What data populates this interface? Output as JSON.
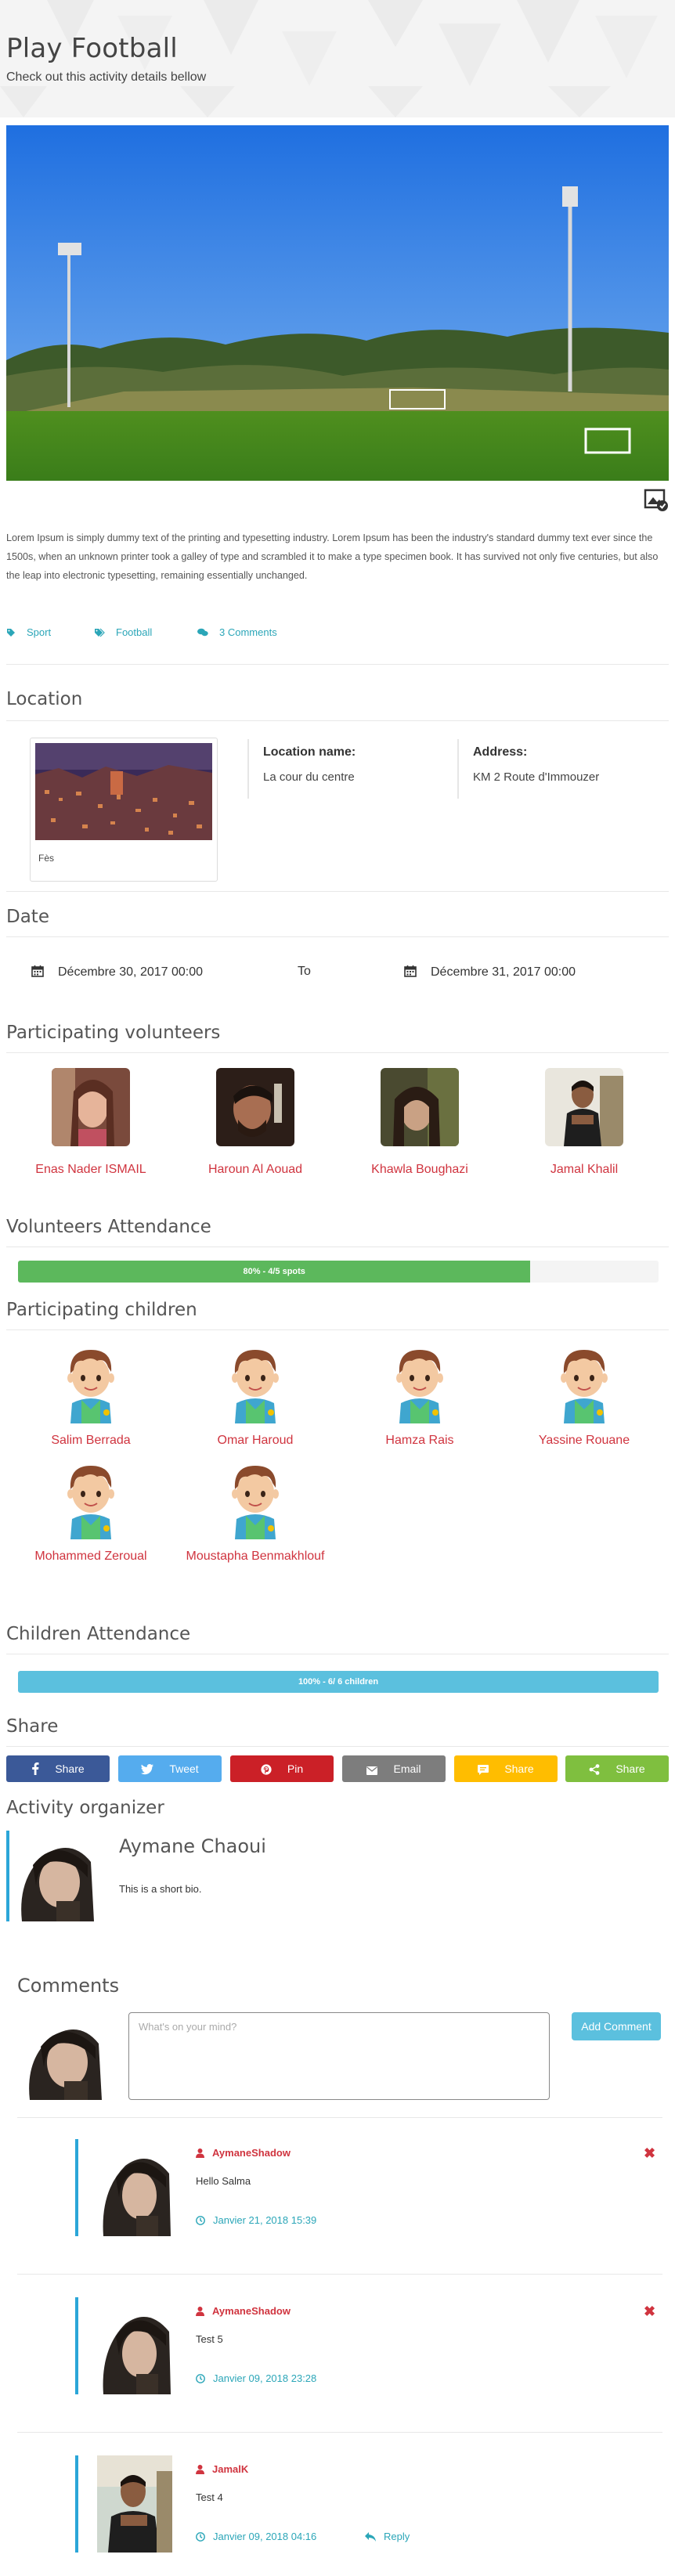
{
  "header": {
    "title": "Play Football",
    "subtitle": "Check out this activity details bellow"
  },
  "hero": {
    "gallery_icon": "image-gallery-icon"
  },
  "description": "Lorem Ipsum is simply dummy text of the printing and typesetting industry. Lorem Ipsum has been the industry's standard dummy text ever since the 1500s, when an unknown printer took a galley of type and scrambled it to make a type specimen book. It has survived not only five centuries, but also the leap into electronic typesetting, remaining essentially unchanged.",
  "tags": [
    {
      "label": "Sport",
      "icon": "tag-icon"
    },
    {
      "label": "Football",
      "icon": "tag-icon"
    },
    {
      "label": "3 Comments",
      "icon": "comments-icon"
    }
  ],
  "location": {
    "section_title": "Location",
    "caption": "Fès",
    "name_label": "Location name:",
    "name_value": "La cour du centre",
    "address_label": "Address:",
    "address_value": "KM 2 Route d'Immouzer"
  },
  "date": {
    "section_title": "Date",
    "start": "Décembre 30, 2017 00:00",
    "to": "To",
    "end": "Décembre 31, 2017 00:00"
  },
  "volunteers": {
    "section_title": "Participating volunteers",
    "items": [
      {
        "name": "Enas Nader ISMAIL"
      },
      {
        "name": "Haroun Al Aouad"
      },
      {
        "name": "Khawla Boughazi"
      },
      {
        "name": "Jamal Khalil"
      }
    ]
  },
  "volunteers_attendance": {
    "section_title": "Volunteers Attendance",
    "label": "80% - 4/5 spots",
    "percent": 80,
    "color": "#5cb85c"
  },
  "children": {
    "section_title": "Participating children",
    "items": [
      {
        "name": "Salim Berrada"
      },
      {
        "name": "Omar Haroud"
      },
      {
        "name": "Hamza Rais"
      },
      {
        "name": "Yassine Rouane"
      },
      {
        "name": "Mohammed Zeroual"
      },
      {
        "name": "Moustapha Benmakhlouf"
      }
    ]
  },
  "children_attendance": {
    "section_title": "Children Attendance",
    "label": "100% - 6/ 6 children",
    "percent": 100,
    "color": "#5bc0de"
  },
  "share": {
    "section_title": "Share",
    "buttons": [
      {
        "label": "Share",
        "icon": "facebook-icon",
        "color": "#3b5998"
      },
      {
        "label": "Tweet",
        "icon": "twitter-icon",
        "color": "#55acee"
      },
      {
        "label": "Pin",
        "icon": "pinterest-icon",
        "color": "#cb2027"
      },
      {
        "label": "Email",
        "icon": "email-icon",
        "color": "#7d7d7d"
      },
      {
        "label": "Share",
        "icon": "sms-icon",
        "color": "#ffbd00"
      },
      {
        "label": "Share",
        "icon": "share-icon",
        "color": "#7fbf3f"
      }
    ]
  },
  "organizer": {
    "section_title": "Activity organizer",
    "name": "Aymane Chaoui",
    "bio": "This is a short bio."
  },
  "comments": {
    "section_title": "Comments",
    "placeholder": "What's on your mind?",
    "add_label": "Add Comment",
    "items": [
      {
        "user": "AymaneShadow",
        "text": "Hello Salma",
        "date": "Janvier 21, 2018 15:39",
        "deletable": true,
        "reply": ""
      },
      {
        "user": "AymaneShadow",
        "text": "Test 5",
        "date": "Janvier 09, 2018 23:28",
        "deletable": true,
        "reply": ""
      },
      {
        "user": "JamalK",
        "text": "Test 4",
        "date": "Janvier 09, 2018 04:16",
        "deletable": false,
        "reply": "Reply"
      }
    ]
  },
  "colors": {
    "accent_red": "#d0343f",
    "accent_teal": "#2ba6b8",
    "accent_blue": "#2ba6d8"
  }
}
